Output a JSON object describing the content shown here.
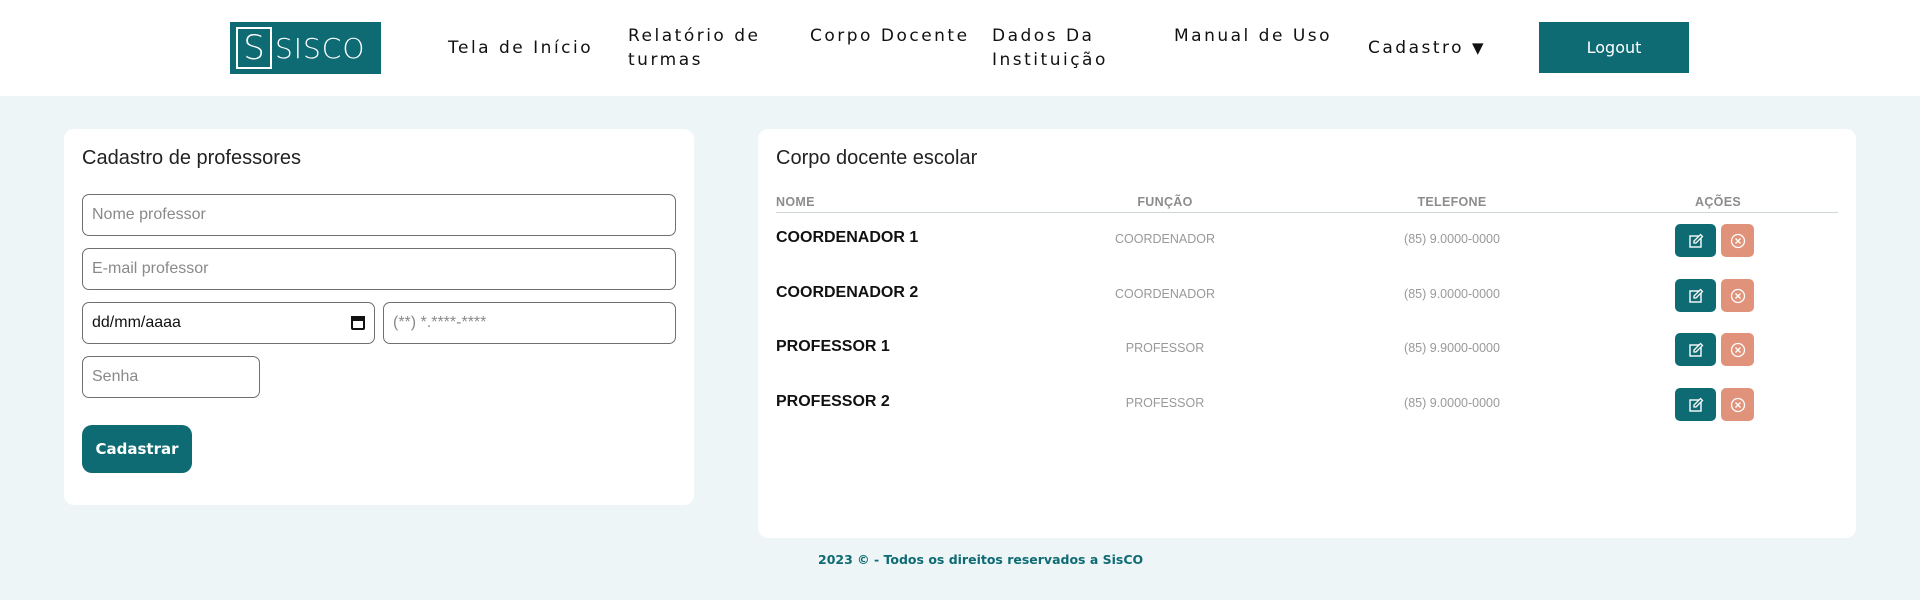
{
  "brand": {
    "logo_letter": "S",
    "logo_text": "SISCO",
    "color": "#0e6b73"
  },
  "nav": {
    "home": "Tela de Início",
    "turmas": "Relatório de turmas",
    "docentes": "Corpo Docente",
    "instituicao": "Dados Da Instituição",
    "manual": "Manual de Uso",
    "cadastro": "Cadastro",
    "cadastro_caret": "▼",
    "logout": "Logout"
  },
  "form": {
    "title": "Cadastro de professores",
    "nome_placeholder": "Nome professor",
    "email_placeholder": "E-mail professor",
    "date_value": "dd/mm/aaaa",
    "tel_placeholder": "(**) *.****-****",
    "senha_placeholder": "Senha",
    "submit": "Cadastrar"
  },
  "list": {
    "title": "Corpo docente escolar",
    "headers": {
      "nome": "NOME",
      "funcao": "FUNÇÃO",
      "telefone": "TELEFONE",
      "acoes": "AÇÕES"
    },
    "rows": [
      {
        "nome": "COORDENADOR 1",
        "funcao": "COORDENADOR",
        "telefone": "(85) 9.0000-0000"
      },
      {
        "nome": "COORDENADOR 2",
        "funcao": "COORDENADOR",
        "telefone": "(85) 9.0000-0000"
      },
      {
        "nome": "PROFESSOR 1",
        "funcao": "PROFESSOR",
        "telefone": "(85) 9.9000-0000"
      },
      {
        "nome": "PROFESSOR 2",
        "funcao": "PROFESSOR",
        "telefone": "(85) 9.0000-0000"
      }
    ]
  },
  "footer": "2023 © - Todos os direitos reservados a SisCO",
  "colors": {
    "primary": "#0e6b73",
    "delete": "#e0937a",
    "background": "#eef5f7"
  }
}
